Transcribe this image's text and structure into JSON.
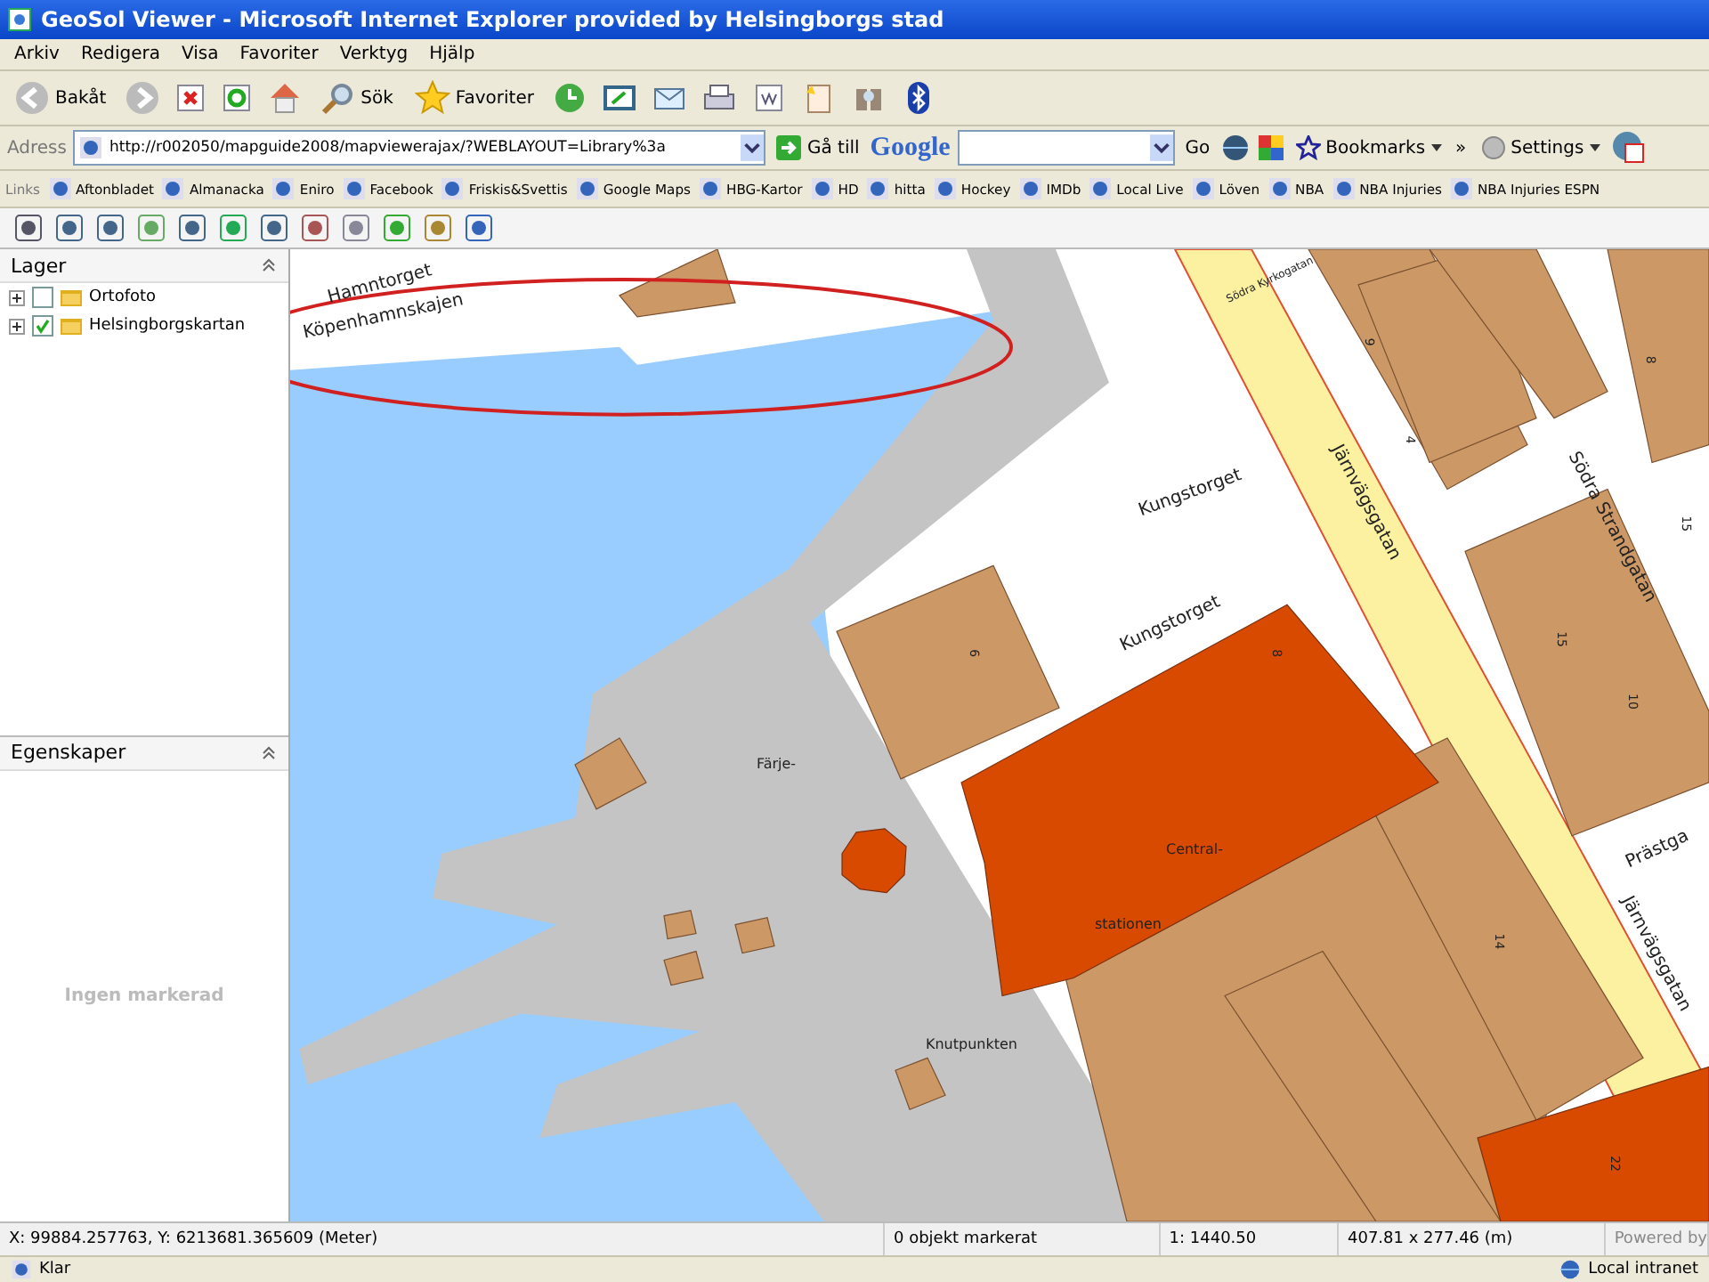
{
  "window": {
    "title": "GeoSol Viewer - Microsoft Internet Explorer provided by Helsingborgs stad"
  },
  "menu": [
    "Arkiv",
    "Redigera",
    "Visa",
    "Favoriter",
    "Verktyg",
    "Hjälp"
  ],
  "toolbar": {
    "back": "Bakåt",
    "search": "Sök",
    "favorites": "Favoriter"
  },
  "address": {
    "label": "Adress",
    "value": "http://r002050/mapguide2008/mapviewerajax/?WEBLAYOUT=Library%3a",
    "go": "Gå till"
  },
  "google": {
    "logo": "Google",
    "go": "Go",
    "bookmarks": "Bookmarks",
    "more": "»",
    "settings": "Settings"
  },
  "links": {
    "label": "Links",
    "items": [
      "Aftonbladet",
      "Almanacka",
      "Eniro",
      "Facebook",
      "Friskis&Svettis",
      "Google Maps",
      "HBG-Kartor",
      "HD",
      "hitta",
      "Hockey",
      "IMDb",
      "Local Live",
      "Löven",
      "NBA",
      "NBA Injuries",
      "NBA Injuries ESPN"
    ]
  },
  "layers_panel": {
    "title": "Lager",
    "items": [
      {
        "label": "Ortofoto",
        "checked": false,
        "expanded": false
      },
      {
        "label": "Helsingborgskartan",
        "checked": true,
        "expanded": false
      }
    ]
  },
  "properties_panel": {
    "title": "Egenskaper",
    "empty_text": "Ingen markerad"
  },
  "map": {
    "labels": [
      {
        "text": "Hamntorget",
        "kind": "street"
      },
      {
        "text": "Köpenhamnskajen",
        "kind": "street"
      },
      {
        "text": "Södra Kyrkogatan",
        "kind": "small"
      },
      {
        "text": "Järnvägsgatan",
        "kind": "street"
      },
      {
        "text": "Kungstorget",
        "kind": "street"
      },
      {
        "text": "Kungstorget",
        "kind": "street"
      },
      {
        "text": "Södra Strandgatan",
        "kind": "street"
      },
      {
        "text": "Järnvägsgatan",
        "kind": "street"
      },
      {
        "text": "Prästga",
        "kind": "street"
      },
      {
        "text": "9",
        "kind": "number"
      },
      {
        "text": "4",
        "kind": "number"
      },
      {
        "text": "8",
        "kind": "number"
      },
      {
        "text": "15",
        "kind": "number"
      },
      {
        "text": "15",
        "kind": "number"
      },
      {
        "text": "10",
        "kind": "number"
      },
      {
        "text": "6",
        "kind": "number"
      },
      {
        "text": "8",
        "kind": "number"
      },
      {
        "text": "14",
        "kind": "number"
      },
      {
        "text": "22",
        "kind": "number"
      },
      {
        "text": "Färje-",
        "kind": "place"
      },
      {
        "text": "Central-",
        "kind": "place"
      },
      {
        "text": "stationen",
        "kind": "place"
      },
      {
        "text": "Knutpunkten",
        "kind": "place"
      }
    ]
  },
  "status_bar": {
    "coordinates": "X: 99884.257763, Y: 6213681.365609 (Meter)",
    "selected": "0 objekt markerat",
    "scale": "1: 1440.50",
    "size": "407.81 x 277.46 (m)",
    "powered": "Powered by"
  },
  "ie_status": {
    "state": "Klar",
    "zone": "Local intranet"
  }
}
